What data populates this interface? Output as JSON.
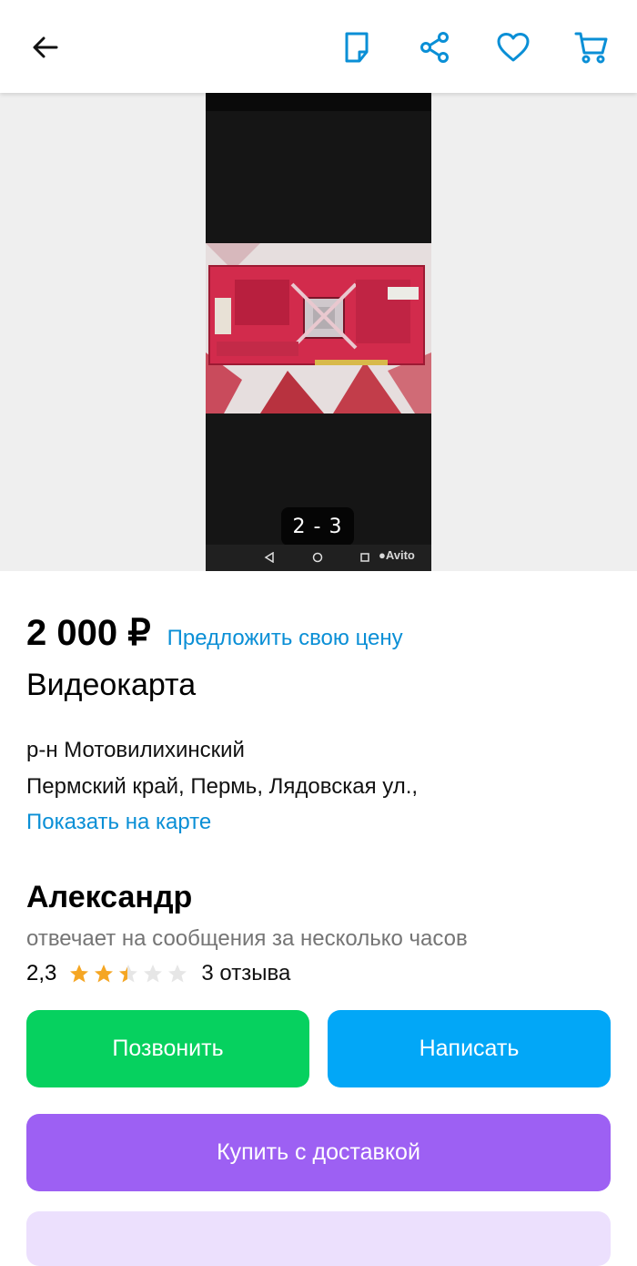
{
  "icons": {
    "back": "arrow-left-icon",
    "note": "note-icon",
    "share": "share-icon",
    "favorite": "heart-icon",
    "cart": "cart-icon"
  },
  "colors": {
    "accent": "#0a8fd6",
    "call": "#06d15f",
    "write": "#02a7f7",
    "buy": "#9d60f3",
    "buy_secondary": "#ece0fd",
    "star": "#f5a623"
  },
  "gallery": {
    "counter": "2 - 3",
    "watermark": "Avito"
  },
  "listing": {
    "price": "2 000 ₽",
    "offer_link": "Предложить свою цену",
    "title": "Видеокарта",
    "district": "р-н Мотовилихинский",
    "address": "Пермский край, Пермь, Лядовская ул.,",
    "map_link": "Показать на карте"
  },
  "seller": {
    "name": "Александр",
    "response_note": "отвечает на сообщения за несколько часов",
    "rating": "2,3",
    "rating_value": 2.3,
    "rating_max": 5,
    "reviews": "3 отзыва"
  },
  "actions": {
    "call": "Позвонить",
    "write": "Написать",
    "buy_delivery": "Купить с доставкой"
  }
}
